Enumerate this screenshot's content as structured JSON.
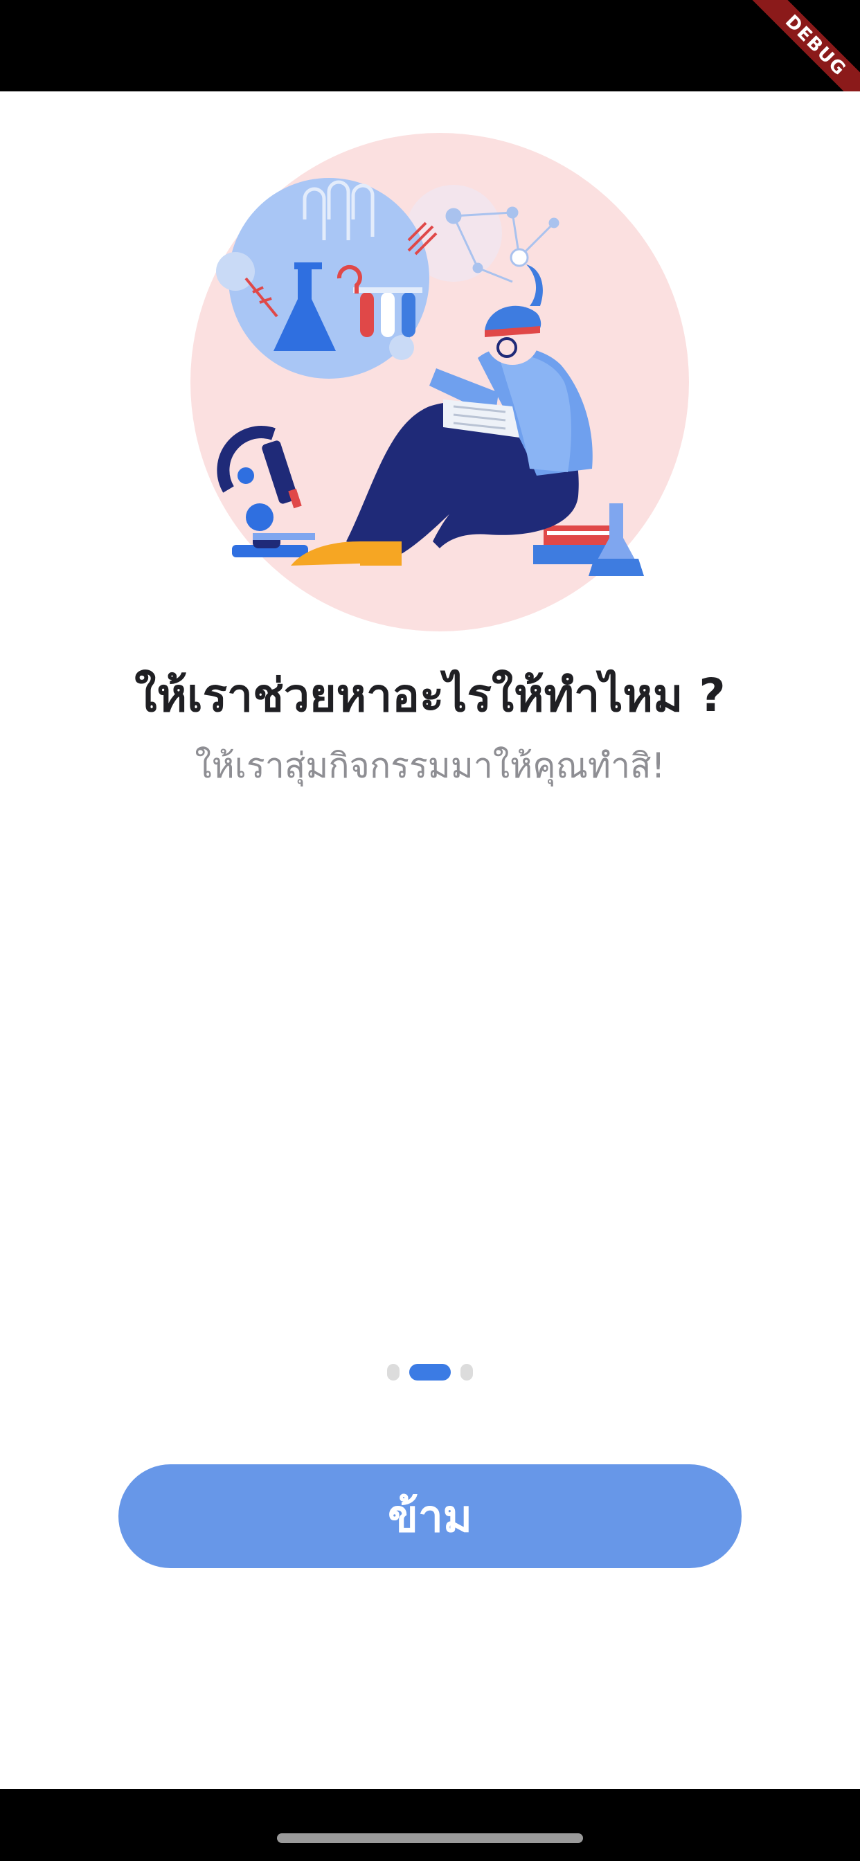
{
  "debug_banner": "DEBUG",
  "onboarding": {
    "title": "ให้เราช่วยหาอะไรให้ทำไหม ?",
    "subtitle": "ให้เราสุ่มกิจกรรมมาให้คุณทำสิ!",
    "skip_label": "ข้าม",
    "page_indicator": {
      "count": 3,
      "active_index": 1
    }
  },
  "colors": {
    "accent": "#3b7be4",
    "button": "#6797e8",
    "title": "#1f1f23",
    "subtitle": "#8e8e93",
    "illustration_circle": "#fbe0e0"
  },
  "illustration": {
    "icon": "scientist-reading-illustration"
  }
}
